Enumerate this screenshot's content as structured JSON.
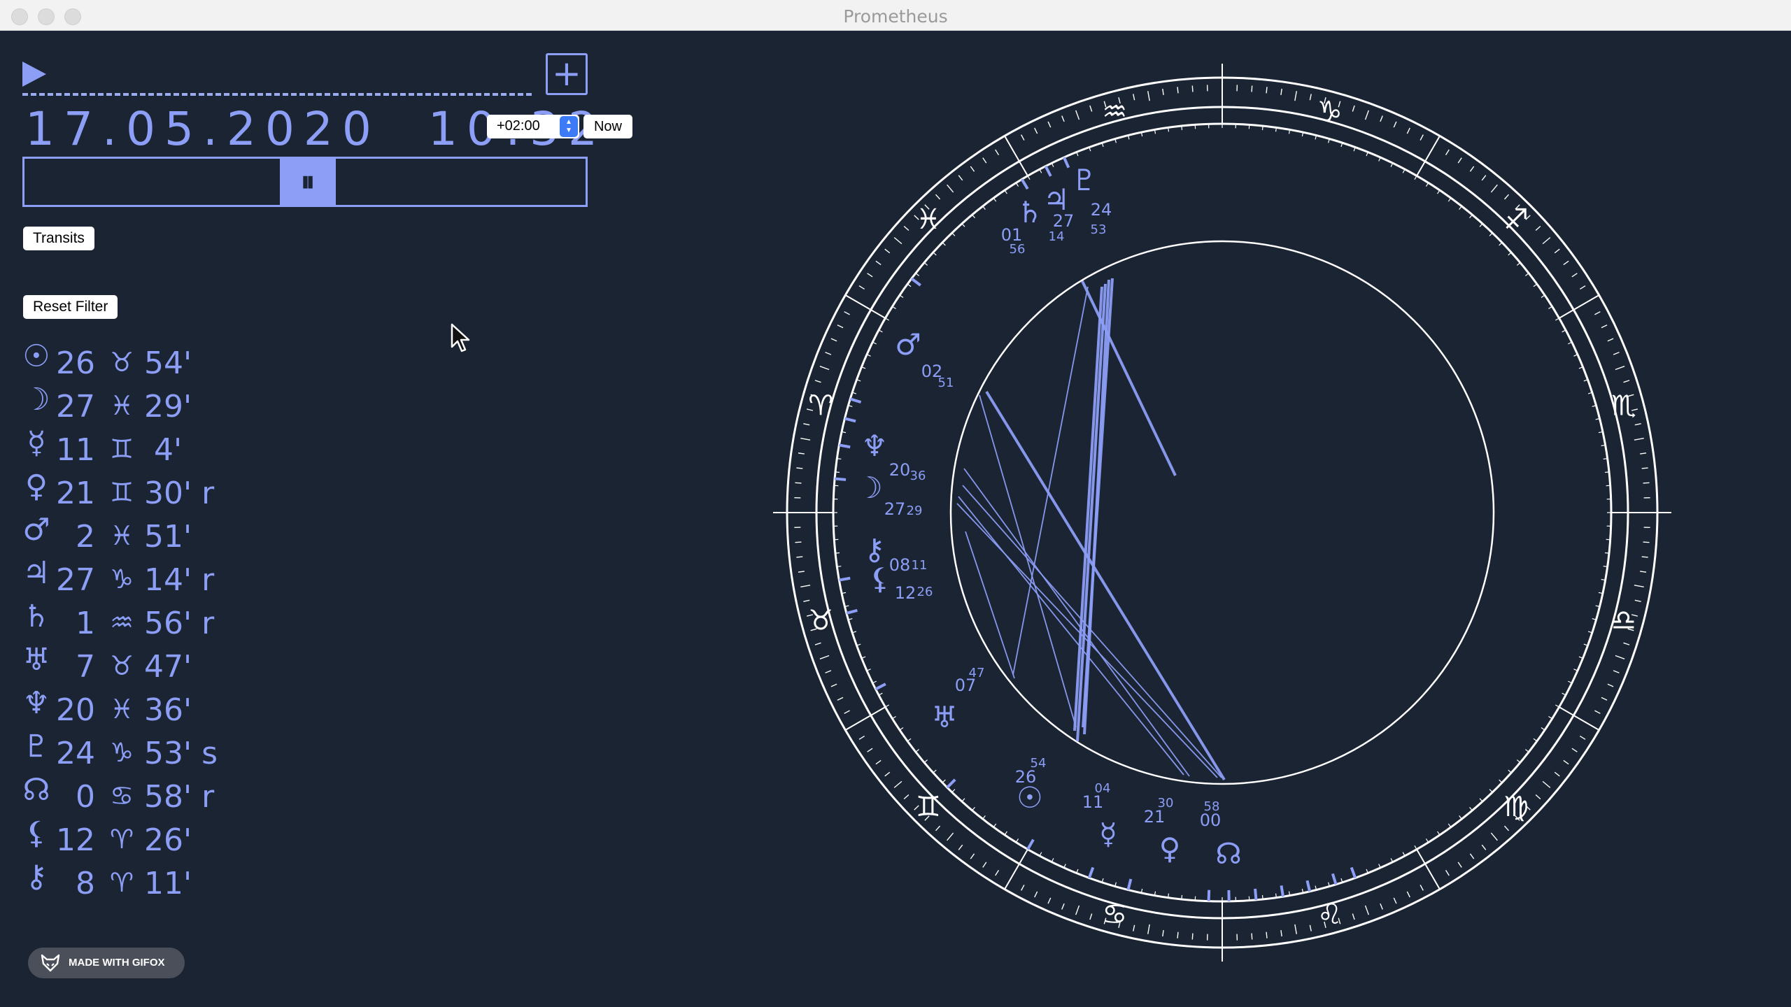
{
  "window": {
    "title": "Prometheus"
  },
  "controls": {
    "datetime": "17.05.2020  10:32",
    "timezone": "+02:00",
    "now_label": "Now",
    "slider_thumb_symbol": "⏸",
    "add_symbol": "+",
    "transits_label": "Transits",
    "reset_filter_label": "Reset Filter",
    "slider_position": 0.5
  },
  "positions": [
    {
      "name": "sun",
      "glyph": "☉",
      "degree": "26",
      "sign": "♉",
      "minutes": "54'"
    },
    {
      "name": "moon",
      "glyph": "☽",
      "degree": "27",
      "sign": "♓",
      "minutes": "29'"
    },
    {
      "name": "mercury",
      "glyph": "☿",
      "degree": "11",
      "sign": "♊",
      "minutes": " 4'"
    },
    {
      "name": "venus",
      "glyph": "♀",
      "degree": "21",
      "sign": "♊",
      "minutes": "30' r"
    },
    {
      "name": "mars",
      "glyph": "♂",
      "degree": "2",
      "sign": "♓",
      "minutes": "51'"
    },
    {
      "name": "jupiter",
      "glyph": "♃",
      "degree": "27",
      "sign": "♑",
      "minutes": "14' r"
    },
    {
      "name": "saturn",
      "glyph": "♄",
      "degree": "1",
      "sign": "♒",
      "minutes": "56' r"
    },
    {
      "name": "uranus",
      "glyph": "♅",
      "degree": "7",
      "sign": "♉",
      "minutes": "47'"
    },
    {
      "name": "neptune",
      "glyph": "♆",
      "degree": "20",
      "sign": "♓",
      "minutes": "36'"
    },
    {
      "name": "pluto",
      "glyph": "♇",
      "degree": "24",
      "sign": "♑",
      "minutes": "53' s"
    },
    {
      "name": "node",
      "glyph": "☊",
      "degree": "0",
      "sign": "♋",
      "minutes": "58' r"
    },
    {
      "name": "lilith",
      "glyph": "⚸",
      "degree": "12",
      "sign": "♈",
      "minutes": "26'"
    },
    {
      "name": "chiron",
      "glyph": "⚷",
      "degree": "8",
      "sign": "♈",
      "minutes": "11'"
    }
  ],
  "wheel": {
    "signs": [
      {
        "name": "capricorn",
        "glyph": "♑"
      },
      {
        "name": "sagittarius",
        "glyph": "♐"
      },
      {
        "name": "scorpio",
        "glyph": "♏"
      },
      {
        "name": "libra",
        "glyph": "♎"
      },
      {
        "name": "virgo",
        "glyph": "♍"
      },
      {
        "name": "leo",
        "glyph": "♌"
      },
      {
        "name": "cancer",
        "glyph": "♋"
      },
      {
        "name": "gemini",
        "glyph": "♊"
      },
      {
        "name": "taurus",
        "glyph": "♉"
      },
      {
        "name": "aries",
        "glyph": "♈"
      },
      {
        "name": "pisces",
        "glyph": "♓"
      },
      {
        "name": "aquarius",
        "glyph": "♒"
      }
    ],
    "planets": [
      {
        "name": "saturn",
        "glyph": "♄",
        "deg": "01",
        "min": "56"
      },
      {
        "name": "jupiter",
        "glyph": "♃",
        "deg": "27",
        "min": "14"
      },
      {
        "name": "pluto",
        "glyph": "♇",
        "deg": "24",
        "min": "53"
      },
      {
        "name": "mars",
        "glyph": "♂",
        "deg": "02",
        "min": "51"
      },
      {
        "name": "neptune",
        "glyph": "♆",
        "deg": "20",
        "min": "36"
      },
      {
        "name": "moon",
        "glyph": "☽",
        "deg": "27",
        "min": "29"
      },
      {
        "name": "chiron",
        "glyph": "⚷",
        "deg": "08",
        "min": "11"
      },
      {
        "name": "lilith",
        "glyph": "⚸",
        "deg": "12",
        "min": "26"
      },
      {
        "name": "uranus",
        "glyph": "♅",
        "deg": "07",
        "min": "47"
      },
      {
        "name": "sun",
        "glyph": "☉",
        "deg": "26",
        "min": "54"
      },
      {
        "name": "mercury",
        "glyph": "☿",
        "deg": "11",
        "min": "04"
      },
      {
        "name": "venus",
        "glyph": "♀",
        "deg": "21",
        "min": "30"
      },
      {
        "name": "node",
        "glyph": "☊",
        "deg": "00",
        "min": "58"
      }
    ]
  },
  "badge": {
    "label": "MADE WITH GIFOX"
  },
  "colors": {
    "background": "#1b2433",
    "accent": "#8c9ef5",
    "wheel_lines": "#ffffff"
  }
}
